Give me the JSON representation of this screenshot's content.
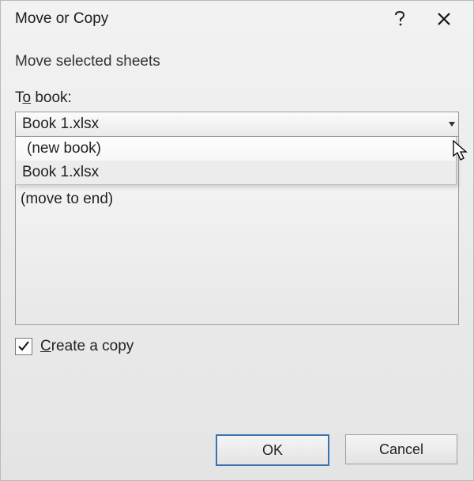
{
  "title": "Move or Copy",
  "heading": "Move selected sheets",
  "toBook": {
    "label_pre": "T",
    "label_mn": "o",
    "label_post": " book:",
    "selected": "Book 1.xlsx",
    "options": {
      "new_book": "(new book)",
      "book1": "Book 1.xlsx"
    }
  },
  "beforeSheet": {
    "move_to_end": "(move to end)"
  },
  "createCopy": {
    "label_pre": "",
    "label_mn": "C",
    "label_post": "reate a copy",
    "checked": true
  },
  "buttons": {
    "ok": "OK",
    "cancel": "Cancel"
  }
}
